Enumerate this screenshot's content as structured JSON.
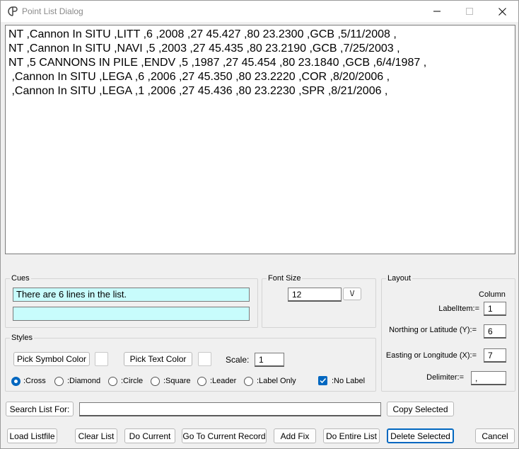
{
  "window": {
    "title": "Point List Dialog"
  },
  "list": {
    "lines": [
      "NT ,Cannon In SITU ,LITT ,6 ,2008 ,27 45.427 ,80 23.2300 ,GCB ,5/11/2008 ,",
      "NT ,Cannon In SITU ,NAVI ,5 ,2003 ,27 45.435 ,80 23.2190 ,GCB ,7/25/2003 ,",
      "NT ,5 CANNONS IN PILE ,ENDV ,5 ,1987 ,27 45.454 ,80 23.1840 ,GCB ,6/4/1987 ,",
      " ,Cannon In SITU ,LEGA ,6 ,2006 ,27 45.350 ,80 23.2220 ,COR ,8/20/2006 ,",
      " ,Cannon In SITU ,LEGA ,1 ,2006 ,27 45.436 ,80 23.2230 ,SPR ,8/21/2006 ,"
    ]
  },
  "cues": {
    "label": "Cues",
    "line1": "There are 6 lines in the list.",
    "line2": ""
  },
  "font_size": {
    "label": "Font Size",
    "value": "12",
    "dropdown_glyph": "\\/"
  },
  "layout": {
    "label": "Layout",
    "column_header": "Column",
    "label_item_label": "LabelItem:=",
    "label_item_value": "1",
    "northing_label": "Northing or Latitude (Y):=",
    "northing_value": "6",
    "easting_label": "Easting or Longitude (X):=",
    "easting_value": "7",
    "delimiter_label": "Delimiter:=",
    "delimiter_value": ","
  },
  "styles": {
    "label": "Styles",
    "pick_symbol_color": "Pick Symbol Color",
    "pick_text_color": "Pick Text Color",
    "scale_label": "Scale:",
    "scale_value": "1",
    "options": [
      ":Cross",
      ":Diamond",
      ":Circle",
      ":Square",
      ":Leader",
      ":Label Only"
    ],
    "selected_option": ":Cross",
    "no_label": ":No Label",
    "no_label_checked": true
  },
  "search": {
    "button": "Search List For:",
    "value": "",
    "copy_selected": "Copy Selected"
  },
  "actions": {
    "load_listfile": "Load Listfile",
    "clear_list": "Clear List",
    "do_current": "Do Current",
    "go_to_current_record": "Go To Current Record",
    "add_fix": "Add Fix",
    "do_entire_list": "Do Entire List",
    "delete_selected": "Delete Selected",
    "cancel": "Cancel"
  },
  "colors": {
    "cue_background": "#c8fcfc",
    "accent": "#0067c0"
  }
}
